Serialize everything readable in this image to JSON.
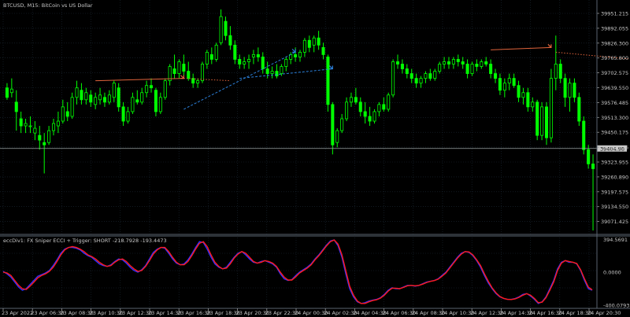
{
  "main_chart": {
    "title": "BTCUSD, M15:  BitCoin vs US Dollar",
    "current_price_label": "39404.98",
    "price_axis_labels": [
      "39951.215",
      "39892.055",
      "39826.300",
      "39765.800",
      "39702.575",
      "39639.550",
      "39576.485",
      "39513.300",
      "39450.175",
      "39387.025",
      "39323.955",
      "39260.890",
      "39197.575",
      "39134.550",
      "39071.425"
    ],
    "candles": [
      [
        39660,
        39680,
        39610,
        39620
      ],
      [
        39640,
        39700,
        39620,
        39655
      ],
      [
        39600,
        39650,
        39480,
        39560
      ],
      [
        39530,
        39560,
        39470,
        39500
      ],
      [
        39500,
        39530,
        39470,
        39510
      ],
      [
        39500,
        39540,
        39470,
        39500
      ],
      [
        39470,
        39520,
        39440,
        39490
      ],
      [
        39460,
        39500,
        39400,
        39440
      ],
      [
        39430,
        39470,
        39300,
        39420
      ],
      [
        39430,
        39500,
        39420,
        39480
      ],
      [
        39480,
        39530,
        39460,
        39510
      ],
      [
        39500,
        39560,
        39470,
        39520
      ],
      [
        39520,
        39610,
        39510,
        39580
      ],
      [
        39560,
        39600,
        39520,
        39540
      ],
      [
        39540,
        39640,
        39530,
        39620
      ],
      [
        39620,
        39690,
        39590,
        39660
      ],
      [
        39650,
        39680,
        39590,
        39610
      ],
      [
        39610,
        39660,
        39590,
        39640
      ],
      [
        39630,
        39650,
        39580,
        39600
      ],
      [
        39590,
        39640,
        39570,
        39620
      ],
      [
        39610,
        39660,
        39590,
        39630
      ],
      [
        39620,
        39640,
        39580,
        39600
      ],
      [
        39600,
        39650,
        39590,
        39630
      ],
      [
        39620,
        39690,
        39600,
        39680
      ],
      [
        39660,
        39680,
        39560,
        39580
      ],
      [
        39580,
        39600,
        39500,
        39520
      ],
      [
        39520,
        39580,
        39510,
        39560
      ],
      [
        39560,
        39640,
        39550,
        39620
      ],
      [
        39610,
        39650,
        39590,
        39600
      ],
      [
        39600,
        39660,
        39590,
        39640
      ],
      [
        39640,
        39690,
        39620,
        39670
      ],
      [
        39670,
        39700,
        39640,
        39660
      ],
      [
        39650,
        39660,
        39540,
        39560
      ],
      [
        39560,
        39640,
        39550,
        39620
      ],
      [
        39620,
        39700,
        39610,
        39690
      ],
      [
        39690,
        39760,
        39670,
        39750
      ],
      [
        39740,
        39800,
        39700,
        39720
      ],
      [
        39720,
        39780,
        39700,
        39770
      ],
      [
        39760,
        39800,
        39710,
        39730
      ],
      [
        39730,
        39770,
        39690,
        39700
      ],
      [
        39700,
        39720,
        39660,
        39680
      ],
      [
        39680,
        39700,
        39660,
        39690
      ],
      [
        39690,
        39770,
        39680,
        39760
      ],
      [
        39760,
        39820,
        39740,
        39810
      ],
      [
        39800,
        39830,
        39760,
        39780
      ],
      [
        39780,
        39850,
        39770,
        39840
      ],
      [
        39850,
        39990,
        39840,
        39960
      ],
      [
        39940,
        39960,
        39860,
        39880
      ],
      [
        39880,
        39920,
        39820,
        39840
      ],
      [
        39840,
        39860,
        39760,
        39780
      ],
      [
        39780,
        39800,
        39740,
        39760
      ],
      [
        39760,
        39790,
        39740,
        39770
      ],
      [
        39770,
        39800,
        39740,
        39780
      ],
      [
        39790,
        39820,
        39760,
        39800
      ],
      [
        39800,
        39830,
        39770,
        39790
      ],
      [
        39790,
        39810,
        39720,
        39740
      ],
      [
        39740,
        39770,
        39700,
        39720
      ],
      [
        39720,
        39750,
        39700,
        39730
      ],
      [
        39730,
        39760,
        39700,
        39710
      ],
      [
        39720,
        39760,
        39710,
        39750
      ],
      [
        39750,
        39790,
        39730,
        39780
      ],
      [
        39780,
        39810,
        39760,
        39800
      ],
      [
        39800,
        39830,
        39770,
        39790
      ],
      [
        39790,
        39820,
        39770,
        39810
      ],
      [
        39810,
        39870,
        39790,
        39860
      ],
      [
        39860,
        39880,
        39810,
        39830
      ],
      [
        39840,
        39880,
        39810,
        39870
      ],
      [
        39870,
        39900,
        39820,
        39840
      ],
      [
        39830,
        39850,
        39780,
        39800
      ],
      [
        39790,
        39800,
        39560,
        39590
      ],
      [
        39590,
        39600,
        39380,
        39420
      ],
      [
        39430,
        39490,
        39410,
        39480
      ],
      [
        39480,
        39550,
        39470,
        39530
      ],
      [
        39530,
        39620,
        39520,
        39600
      ],
      [
        39600,
        39640,
        39580,
        39620
      ],
      [
        39620,
        39660,
        39590,
        39600
      ],
      [
        39600,
        39620,
        39540,
        39560
      ],
      [
        39560,
        39600,
        39510,
        39540
      ],
      [
        39540,
        39580,
        39500,
        39520
      ],
      [
        39520,
        39570,
        39510,
        39560
      ],
      [
        39560,
        39600,
        39540,
        39590
      ],
      [
        39590,
        39620,
        39560,
        39570
      ],
      [
        39570,
        39640,
        39560,
        39630
      ],
      [
        39630,
        39780,
        39620,
        39770
      ],
      [
        39770,
        39800,
        39740,
        39760
      ],
      [
        39760,
        39780,
        39720,
        39740
      ],
      [
        39740,
        39760,
        39700,
        39720
      ],
      [
        39720,
        39740,
        39680,
        39700
      ],
      [
        39700,
        39720,
        39660,
        39680
      ],
      [
        39680,
        39710,
        39660,
        39700
      ],
      [
        39700,
        39730,
        39680,
        39720
      ],
      [
        39720,
        39740,
        39690,
        39700
      ],
      [
        39700,
        39740,
        39690,
        39730
      ],
      [
        39730,
        39770,
        39720,
        39760
      ],
      [
        39760,
        39790,
        39740,
        39770
      ],
      [
        39770,
        39790,
        39740,
        39760
      ],
      [
        39760,
        39790,
        39740,
        39780
      ],
      [
        39780,
        39800,
        39750,
        39770
      ],
      [
        39770,
        39790,
        39740,
        39760
      ],
      [
        39760,
        39780,
        39700,
        39720
      ],
      [
        39720,
        39770,
        39710,
        39760
      ],
      [
        39760,
        39780,
        39730,
        39750
      ],
      [
        39750,
        39780,
        39740,
        39770
      ],
      [
        39770,
        39790,
        39750,
        39760
      ],
      [
        39760,
        39780,
        39700,
        39720
      ],
      [
        39720,
        39740,
        39680,
        39700
      ],
      [
        39700,
        39720,
        39630,
        39650
      ],
      [
        39650,
        39700,
        39620,
        39680
      ],
      [
        39680,
        39720,
        39650,
        39700
      ],
      [
        39700,
        39720,
        39660,
        39670
      ],
      [
        39670,
        39690,
        39600,
        39620
      ],
      [
        39620,
        39660,
        39590,
        39640
      ],
      [
        39640,
        39660,
        39560,
        39580
      ],
      [
        39580,
        39620,
        39560,
        39600
      ],
      [
        39600,
        39610,
        39440,
        39460
      ],
      [
        39460,
        39600,
        39440,
        39580
      ],
      [
        39580,
        39600,
        39420,
        39450
      ],
      [
        39450,
        39740,
        39430,
        39700
      ],
      [
        39700,
        39880,
        39650,
        39760
      ],
      [
        39760,
        39780,
        39680,
        39700
      ],
      [
        39700,
        39720,
        39580,
        39620
      ],
      [
        39620,
        39700,
        39560,
        39680
      ],
      [
        39680,
        39700,
        39600,
        39620
      ],
      [
        39620,
        39640,
        39500,
        39520
      ],
      [
        39520,
        39540,
        39380,
        39400
      ],
      [
        39400,
        39420,
        39320,
        39340
      ],
      [
        39340,
        39380,
        39060,
        39320
      ]
    ],
    "trend_lines": [
      {
        "from": [
          19,
          39690
        ],
        "to": [
          38,
          39700
        ],
        "color": "#e0643c",
        "style": "solid",
        "arrow": true
      },
      {
        "from": [
          38,
          39700
        ],
        "to": [
          48,
          39690
        ],
        "color": "#e0643c",
        "style": "dotted",
        "arrow": false
      },
      {
        "from": [
          38,
          39570
        ],
        "to": [
          62,
          39810
        ],
        "color": "#2b7fd8",
        "style": "dashed",
        "arrow": true
      },
      {
        "from": [
          50,
          39700
        ],
        "to": [
          70,
          39740
        ],
        "color": "#2b7fd8",
        "style": "dashed",
        "arrow": true
      },
      {
        "from": [
          104,
          39820
        ],
        "to": [
          117,
          39830
        ],
        "color": "#e0643c",
        "style": "solid",
        "arrow": true
      },
      {
        "from": [
          118,
          39810
        ],
        "to": [
          146,
          39760
        ],
        "color": "#e0643c",
        "style": "dotted",
        "arrow": true
      }
    ]
  },
  "indicator": {
    "title": "eccDiv1: FX Sniper ECCI + Trigger: SHORT -218.7928 -193.4473",
    "axis_labels": [
      "394.5691",
      "0.0000",
      "-400.0793"
    ],
    "series": [
      {
        "name": "ECCI",
        "color": "#3030ff",
        "values": [
          10,
          -20,
          -60,
          -120,
          -180,
          -220,
          -200,
          -150,
          -100,
          -50,
          -30,
          -10,
          20,
          80,
          150,
          230,
          280,
          300,
          300,
          290,
          270,
          230,
          200,
          180,
          140,
          100,
          80,
          70,
          90,
          130,
          160,
          150,
          110,
          60,
          20,
          0,
          30,
          80,
          160,
          240,
          280,
          300,
          290,
          230,
          160,
          110,
          90,
          100,
          150,
          220,
          300,
          370,
          360,
          280,
          180,
          100,
          60,
          40,
          60,
          120,
          180,
          230,
          250,
          210,
          160,
          120,
          110,
          130,
          140,
          120,
          100,
          60,
          -20,
          -80,
          -100,
          -90,
          -40,
          0,
          30,
          60,
          100,
          160,
          210,
          270,
          330,
          380,
          390,
          320,
          180,
          -20,
          -200,
          -300,
          -360,
          -380,
          -370,
          -350,
          -340,
          -330,
          -310,
          -270,
          -220,
          -190,
          -200,
          -200,
          -180,
          -160,
          -160,
          -170,
          -160,
          -140,
          -120,
          -110,
          -100,
          -80,
          -40,
          0,
          60,
          120,
          180,
          230,
          250,
          240,
          200,
          140,
          60,
          -40,
          -130,
          -200,
          -260,
          -300,
          -320,
          -330,
          -330,
          -320,
          -300,
          -270,
          -260,
          -290,
          -330,
          -380,
          -360,
          -300,
          -200,
          -100,
          40,
          120,
          140,
          120,
          120,
          100,
          20,
          -100,
          -200,
          -220
        ]
      },
      {
        "name": "Trigger",
        "color": "#ff1a1a",
        "values": [
          0,
          -10,
          -40,
          -100,
          -160,
          -200,
          -210,
          -170,
          -120,
          -70,
          -40,
          -20,
          10,
          60,
          130,
          210,
          270,
          300,
          310,
          300,
          280,
          250,
          210,
          190,
          160,
          120,
          90,
          70,
          80,
          120,
          150,
          160,
          130,
          80,
          40,
          10,
          20,
          70,
          140,
          220,
          270,
          300,
          300,
          250,
          180,
          120,
          90,
          90,
          130,
          200,
          280,
          350,
          370,
          310,
          210,
          120,
          70,
          40,
          50,
          100,
          170,
          220,
          250,
          230,
          180,
          130,
          110,
          120,
          140,
          130,
          110,
          70,
          0,
          -60,
          -95,
          -95,
          -55,
          -10,
          20,
          50,
          90,
          150,
          200,
          260,
          320,
          370,
          390,
          340,
          210,
          20,
          -170,
          -280,
          -350,
          -380,
          -380,
          -360,
          -345,
          -335,
          -315,
          -280,
          -230,
          -195,
          -195,
          -200,
          -185,
          -165,
          -160,
          -165,
          -160,
          -145,
          -125,
          -112,
          -102,
          -85,
          -50,
          -10,
          50,
          110,
          170,
          220,
          250,
          245,
          210,
          150,
          80,
          -20,
          -110,
          -190,
          -250,
          -295,
          -318,
          -330,
          -332,
          -325,
          -305,
          -280,
          -262,
          -280,
          -320,
          -370,
          -365,
          -310,
          -220,
          -120,
          20,
          110,
          140,
          130,
          120,
          105,
          30,
          -80,
          -180,
          -215
        ]
      }
    ]
  },
  "time_axis_labels": [
    "23 Apr 2022",
    "23 Apr 06:30",
    "23 Apr 08:30",
    "23 Apr 10:30",
    "23 Apr 12:30",
    "23 Apr 14:30",
    "23 Apr 16:30",
    "23 Apr 18:30",
    "23 Apr 20:30",
    "23 Apr 22:30",
    "24 Apr 00:30",
    "24 Apr 02:30",
    "24 Apr 04:30",
    "24 Apr 06:30",
    "24 Apr 08:30",
    "24 Apr 10:30",
    "24 Apr 12:30",
    "24 Apr 14:30",
    "24 Apr 16:30",
    "24 Apr 18:30",
    "24 Apr 20:30"
  ],
  "colors": {
    "background": "#000000",
    "grid": "#1d2a36",
    "bull": "#00ff00",
    "bear": "#00ff00",
    "axis": "#9a9a9a",
    "price_line": "#9aa3a3"
  }
}
